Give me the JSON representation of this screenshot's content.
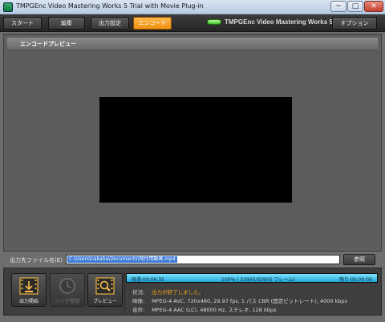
{
  "window": {
    "title": "TMPGEnc Video Mastering Works 5 Trial with Movie Plug-in",
    "minimize": "─",
    "maximize": "□",
    "close": "✕"
  },
  "nav": {
    "start": "スタート",
    "edit": "編集",
    "output_settings": "出力設定",
    "encode": "エンコード",
    "brand": "TMPGEnc Video Mastering Works 5",
    "options": "オプション"
  },
  "preview": {
    "header": "エンコードプレビュー"
  },
  "output": {
    "label": "出力先ファイル名(E)",
    "path": "C:\\Users\\nakaba\\Documents\\残住用動画.mp4",
    "browse": "参照"
  },
  "actions": {
    "start_output": "出力開始",
    "batch": "バッチ登録",
    "preview": "プレビュー"
  },
  "progress": {
    "elapsed": "経過:00:06:35",
    "percent_text": "100% ( 32905/32905 フレーム)",
    "remaining": "残り:00:00:00",
    "fraction": 1.0
  },
  "info": {
    "status_key": "状況:",
    "status_val": "出力が終了しました。",
    "video_key": "映像:",
    "video_val": "MPEG-4 AVC, 720x480, 29.97 fps, 1 パス CBR (固定ビットレート), 4000 kbps",
    "audio_key": "音声:",
    "audio_val": "MPEG-4 AAC (LC), 48000 Hz, ステレオ, 128 kbps"
  },
  "colors": {
    "accent": "#f5a020",
    "progress": "#3ec0ec",
    "status_text": "#f0a21a"
  }
}
